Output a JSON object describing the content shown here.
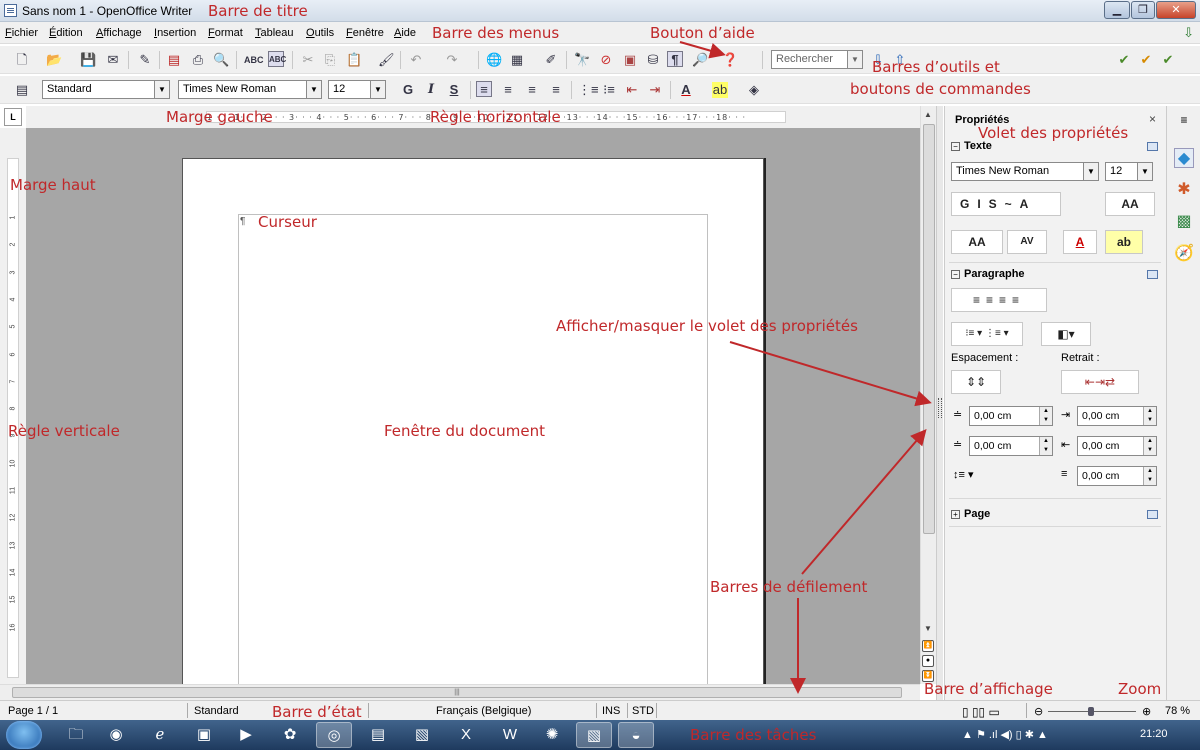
{
  "colors": {
    "annotation": "#c0282a",
    "doc_background": "#a6a6a6",
    "taskbar": "#2b4a72"
  },
  "window": {
    "title": "Sans nom 1 - OpenOffice Writer",
    "minimize_icon": "minimize-icon",
    "maximize_icon": "maximize-icon",
    "close_icon": "close-icon"
  },
  "menus": [
    "Fichier",
    "Édition",
    "Affichage",
    "Insertion",
    "Format",
    "Tableau",
    "Outils",
    "Fenêtre",
    "Aide"
  ],
  "toolbar": {
    "search_placeholder": "Rechercher",
    "style": "Standard",
    "font": "Times New Roman",
    "size": "12",
    "bold": "G",
    "italic": "I",
    "underline": "S"
  },
  "ruler_h": {
    "scale": "1 · · ·1· · · 2· · · 3· · · 4· · · 5· · · 6· · · 7· · · 8· · · 9· · ·10· · ·11· · ·12· · ·13· · ·14· · ·15· · ·16· · ·17· · ·18· · ·"
  },
  "ruler_v_ticks": [
    "1",
    "2",
    "3",
    "4",
    "5",
    "6",
    "7",
    "8",
    "9",
    "10",
    "11",
    "12",
    "13",
    "14",
    "15",
    "16"
  ],
  "document": {
    "cursor_mark": "¶"
  },
  "properties": {
    "title": "Propriétés",
    "close": "×",
    "text_section": "Texte",
    "font": "Times New Roman",
    "size": "12",
    "paragraph_section": "Paragraphe",
    "spacing_label": "Espacement :",
    "indent_label": "Retrait :",
    "spacing_above": "0,00 cm",
    "spacing_below": "0,00 cm",
    "indent_before": "0,00 cm",
    "indent_after": "0,00 cm",
    "indent_first": "0,00 cm",
    "page_section": "Page"
  },
  "statusbar": {
    "page": "Page 1 / 1",
    "style": "Standard",
    "language": "Français (Belgique)",
    "insert_mode": "INS",
    "selection_mode": "STD",
    "zoom": "78 %"
  },
  "taskbar": {
    "time": "21:20"
  },
  "annotations": {
    "title_bar": "Barre de titre",
    "menu_bar": "Barre des menus",
    "help_button": "Bouton d’aide",
    "toolbars_1": "Barres d’outils et",
    "toolbars_2": "boutons de commandes",
    "left_margin": "Marge gauche",
    "h_ruler": "Règle horizontale",
    "props_pane": "Volet des propriétés",
    "top_margin": "Marge haut",
    "cursor": "Curseur",
    "toggle_props": "Afficher/masquer le volet des propriétés",
    "v_ruler": "Règle verticale",
    "doc_window": "Fenêtre du document",
    "scrollbars": "Barres de défilement",
    "view_bar": "Barre d’affichage",
    "zoom": "Zoom",
    "status_bar": "Barre d’état",
    "taskbar": "Barre des tâches"
  }
}
